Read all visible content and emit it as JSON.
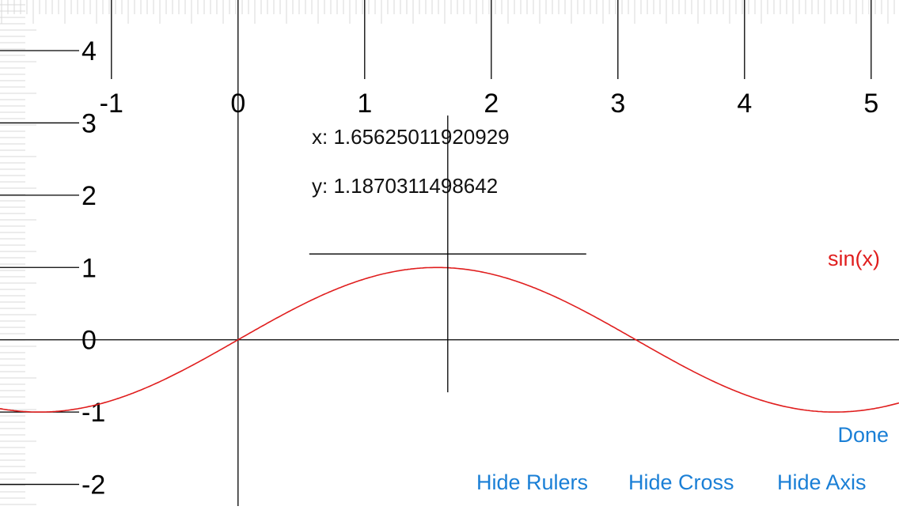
{
  "chart_data": {
    "type": "line",
    "title": "",
    "xlabel": "",
    "ylabel": "",
    "xlim": [
      -1.88,
      5.22
    ],
    "ylim": [
      -2.3,
      4.7
    ],
    "x_ticks": [
      -1,
      0,
      1,
      2,
      3,
      4,
      5
    ],
    "x_tick_labels": [
      "-1",
      "0",
      "1",
      "2",
      "3",
      "4",
      "5"
    ],
    "y_ticks": [
      -2,
      -1,
      0,
      1,
      2,
      3,
      4
    ],
    "y_tick_labels": [
      "-2",
      "-1",
      "0",
      "1",
      "2",
      "3",
      "4"
    ],
    "series": [
      {
        "name": "sin(x)",
        "function": "sin(x)",
        "color": "#e01e1e"
      }
    ],
    "grid": false,
    "legend_position": "right",
    "crosshair": {
      "x": 1.65625011920929,
      "y": 1.1870311498642
    }
  },
  "readout": {
    "x_label": "x: 1.65625011920929",
    "y_label": "y: 1.1870311498642"
  },
  "buttons": {
    "done": "Done",
    "hide_rulers": "Hide Rulers",
    "hide_cross": "Hide Cross",
    "hide_axis": "Hide Axis"
  },
  "colors": {
    "accent": "#1a7fd6",
    "curve": "#e01e1e",
    "axis": "#000000",
    "ruler_ticks": "#d8d8d8"
  }
}
